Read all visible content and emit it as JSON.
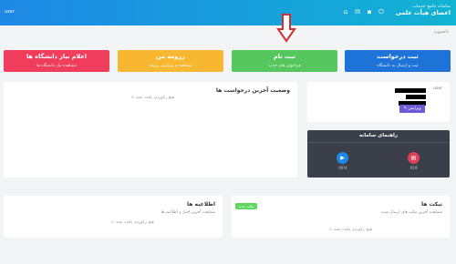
{
  "header": {
    "brand_line1": "سامانه جامع خدمات",
    "brand_line2": "اعضای هیأت علمی",
    "user_label": "user",
    "icons": [
      "home-icon",
      "mail-icon",
      "folder-icon",
      "power-icon"
    ]
  },
  "breadcrumb": "داشبورد",
  "cards": [
    {
      "title": "ثبت درخواست",
      "subtitle": "ثبت و ارسال به دانشگاه",
      "color": "#1e73d8"
    },
    {
      "title": "ثبت نام",
      "subtitle": "فراخوان های جذب",
      "color": "#56c75e"
    },
    {
      "title": "رزومه من",
      "subtitle": "مشاهده و ویرایش رزومه",
      "color": "#f7b731"
    },
    {
      "title": "اعلام نیاز دانشگاه ها",
      "subtitle": "مشاهده نیاز دانشگاه ها",
      "color": "#ef3d5b"
    }
  ],
  "profile": {
    "user_label": "user",
    "edit_label": "ویرایش"
  },
  "requests_panel": {
    "title": "وضعیت آخرین درخواست ها",
    "empty": "هیچ رکوردی یافت نشد"
  },
  "guide": {
    "title": "راهنمای سامانه",
    "pdf_label": "PDF",
    "mp4_label": "MP4"
  },
  "tickets": {
    "title": "تیکت ها",
    "subtitle": "مشاهده آخرین تیکت های ارسال شده",
    "badge": "تیکت جدید",
    "empty": "هیچ رکوردی یافت نشد"
  },
  "news": {
    "title": "اطلاعیه ها",
    "subtitle": "مشاهده آخرین اخبار و اطلاعیه ها",
    "empty": "هیچ رکوردی یافت نشد"
  }
}
